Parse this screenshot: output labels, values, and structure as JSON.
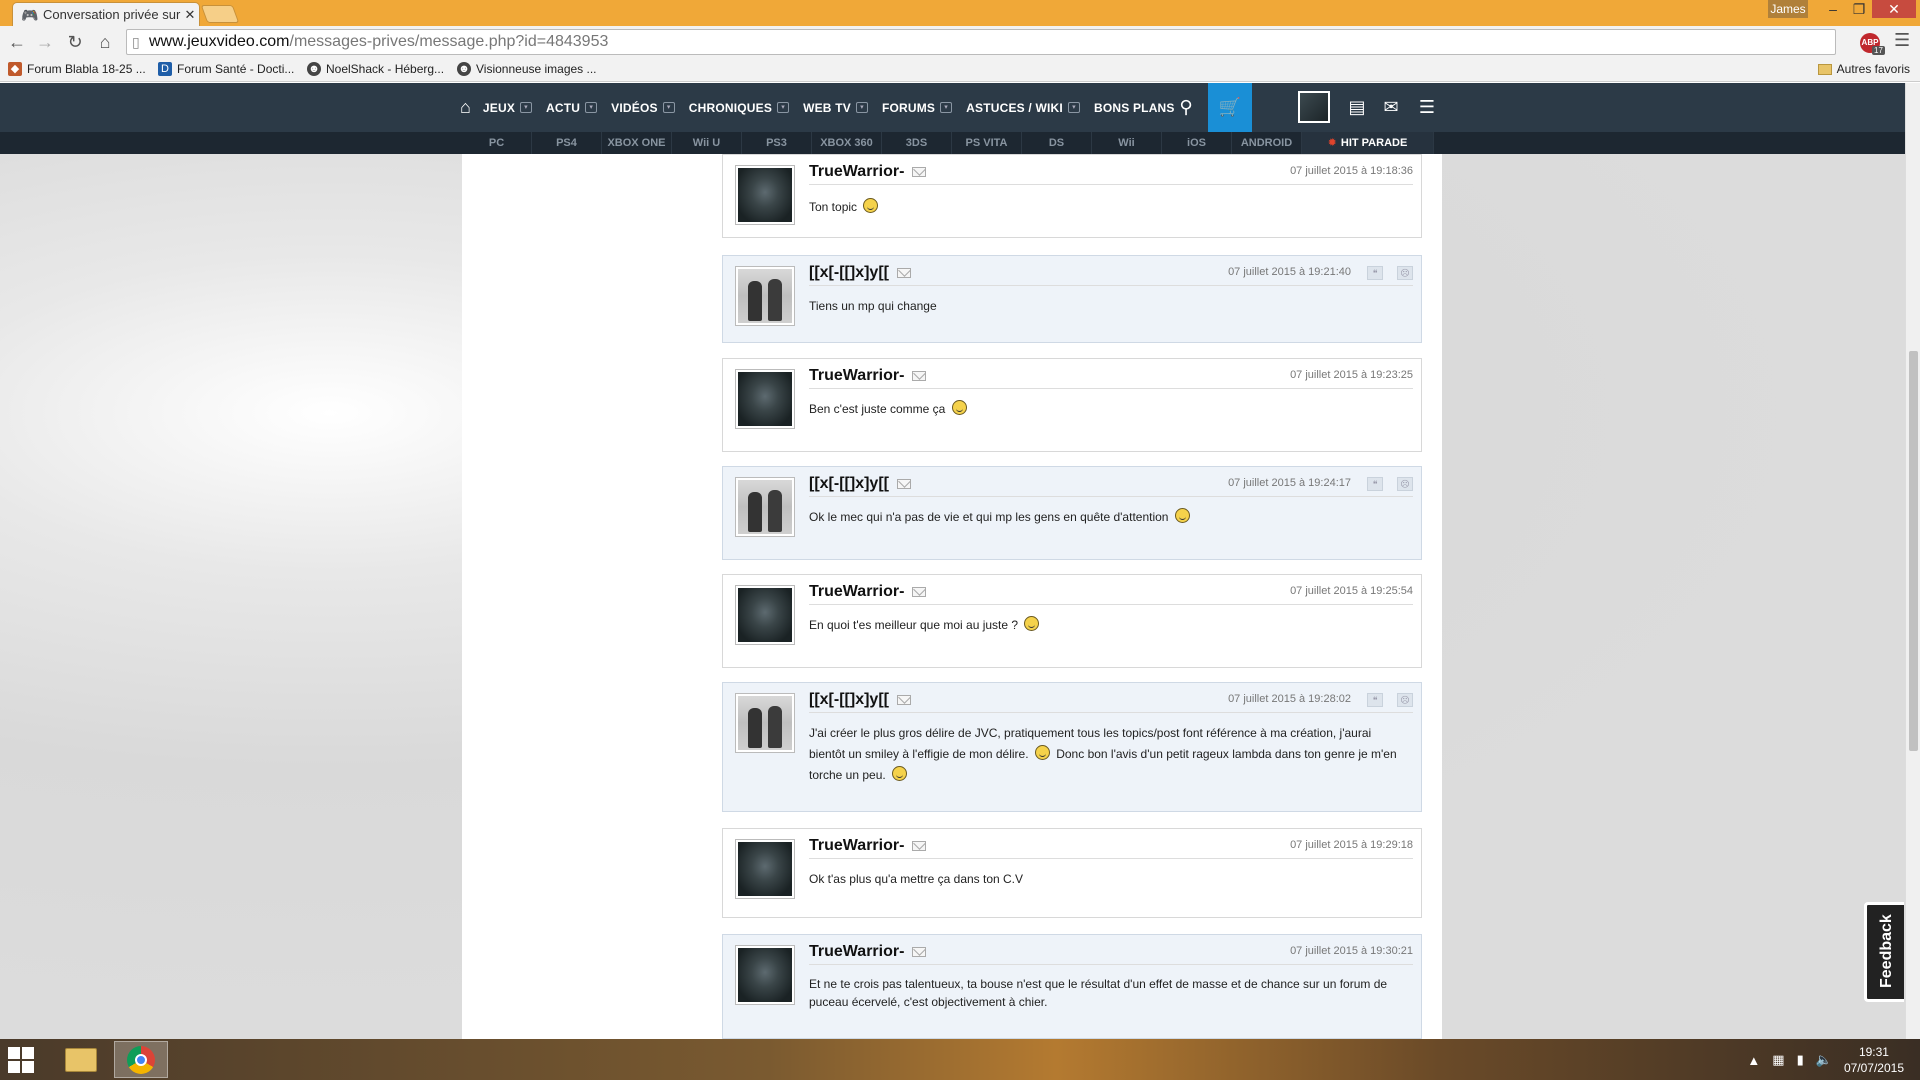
{
  "browser": {
    "tab_title": "Conversation privée sur Je",
    "url_host": "www.jeuxvideo.com",
    "url_path": "/messages-prives/message.php?id=4843953",
    "user": "James",
    "abp_label": "ABP",
    "abp_count": "17",
    "bookmarks": [
      "Forum Blabla 18-25 ...",
      "Forum Santé - Docti...",
      "NoelShack - Héberg...",
      "Visionneuse images ..."
    ],
    "other_bookmarks": "Autres favoris"
  },
  "site_nav": {
    "items": [
      "JEUX",
      "ACTU",
      "VIDÉOS",
      "CHRONIQUES",
      "WEB TV",
      "FORUMS",
      "ASTUCES / WIKI",
      "BONS PLANS"
    ]
  },
  "platforms": [
    "PC",
    "PS4",
    "XBOX ONE",
    "Wii U",
    "PS3",
    "XBOX 360",
    "3DS",
    "PS VITA",
    "DS",
    "Wii",
    "iOS",
    "ANDROID"
  ],
  "hit_parade": "HIT PARADE",
  "messages": [
    {
      "author": "TrueWarrior-",
      "date": "07 juillet 2015 à 19:18:36",
      "text": "Ton topic"
    },
    {
      "author": "[[x[-[[]x]y[[",
      "date": "07 juillet 2015 à 19:21:40",
      "text": "Tiens un mp qui change"
    },
    {
      "author": "TrueWarrior-",
      "date": "07 juillet 2015 à 19:23:25",
      "text": "Ben c'est juste comme ça"
    },
    {
      "author": "[[x[-[[]x]y[[",
      "date": "07 juillet 2015 à 19:24:17",
      "text": "Ok le mec qui n'a pas de vie et qui mp les gens en quête d'attention"
    },
    {
      "author": "TrueWarrior-",
      "date": "07 juillet 2015 à 19:25:54",
      "text": "En quoi t'es meilleur que moi au juste ?"
    },
    {
      "author": "[[x[-[[]x]y[[",
      "date": "07 juillet 2015 à 19:28:02",
      "text_1": "J'ai créer le plus gros délire de JVC, pratiquement tous les topics/post font référence à ma création, j'aurai bientôt un smiley à l'effigie de mon délire.",
      "text_2": "Donc bon l'avis d'un petit rageux lambda dans ton genre je m'en torche un peu."
    },
    {
      "author": "TrueWarrior-",
      "date": "07 juillet 2015 à 19:29:18",
      "text": "Ok t'as plus qu'a mettre ça dans ton C.V"
    },
    {
      "author": "TrueWarrior-",
      "date": "07 juillet 2015 à 19:30:21",
      "text": "Et ne te crois pas talentueux, ta bouse n'est que le résultat d'un effet de masse et de chance sur un forum de puceau écervelé, c'est objectivement à chier."
    }
  ],
  "feedback": "Feedback",
  "taskbar": {
    "time": "19:31",
    "date": "07/07/2015"
  }
}
